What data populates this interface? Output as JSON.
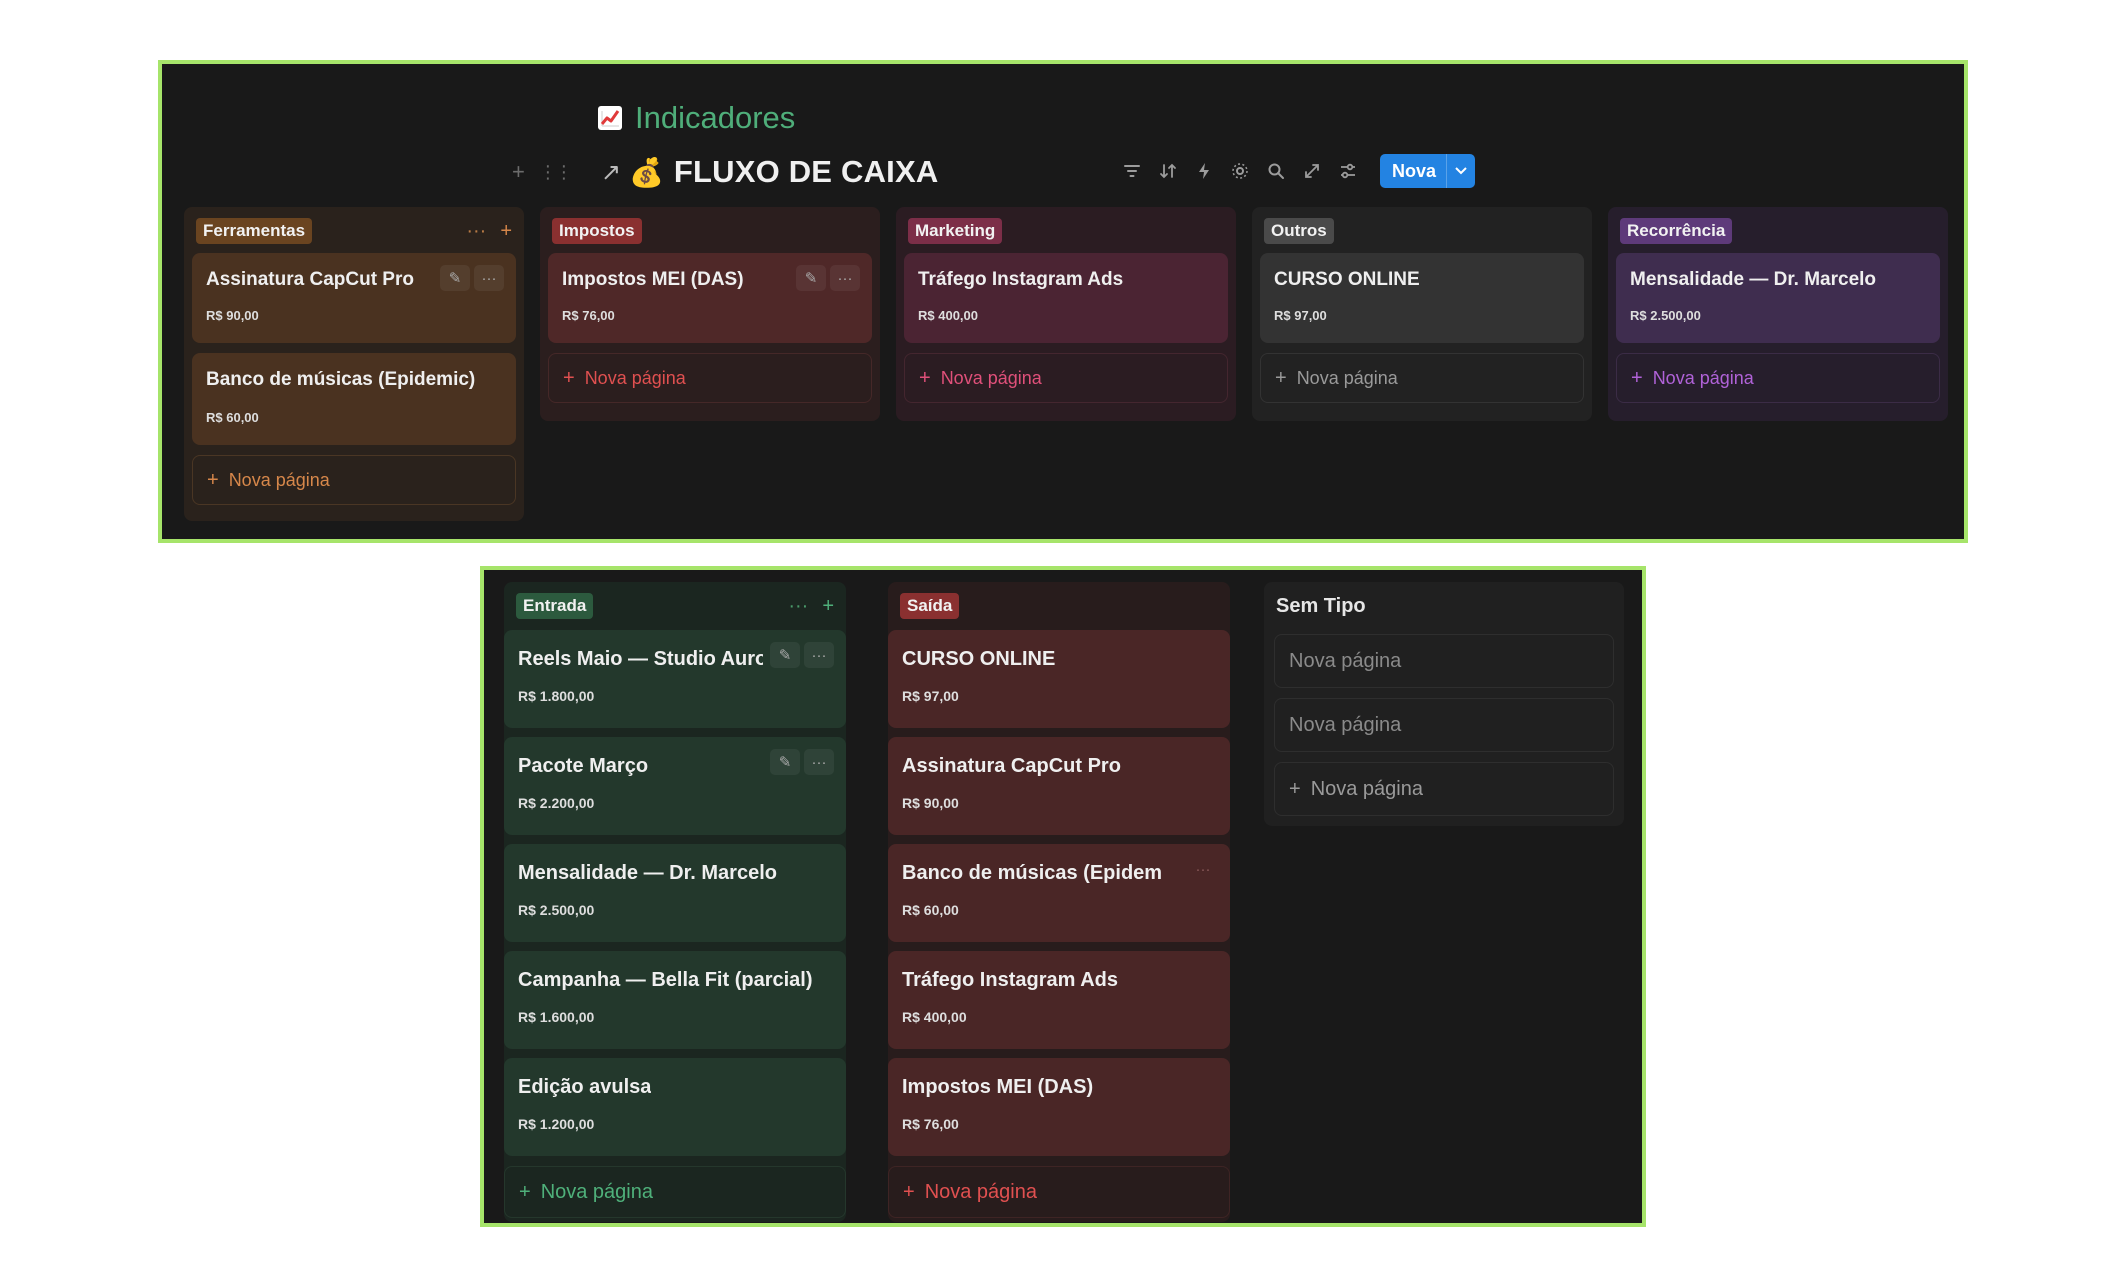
{
  "header": {
    "section_title": "Indicadores",
    "database_title": "FLUXO DE CAIXA",
    "new_button_label": "Nova",
    "icons": [
      "trending-up-icon",
      "money-bag-icon",
      "filter-icon",
      "sort-icon",
      "lightning-icon",
      "settings-icon",
      "search-icon",
      "expand-icon",
      "properties-icon"
    ]
  },
  "top_board": {
    "new_page_label": "Nova página",
    "columns": [
      {
        "name": "Ferramentas",
        "cards": [
          {
            "title": "Assinatura CapCut Pro",
            "value": "R$ 90,00"
          },
          {
            "title": "Banco de músicas (Epidemic)",
            "value": "R$ 60,00"
          }
        ]
      },
      {
        "name": "Impostos",
        "cards": [
          {
            "title": "Impostos MEI (DAS)",
            "value": "R$ 76,00"
          }
        ]
      },
      {
        "name": "Marketing",
        "cards": [
          {
            "title": "Tráfego Instagram Ads",
            "value": "R$ 400,00"
          }
        ]
      },
      {
        "name": "Outros",
        "cards": [
          {
            "title": "CURSO ONLINE",
            "value": "R$ 97,00"
          }
        ]
      },
      {
        "name": "Recorrência",
        "cards": [
          {
            "title": "Mensalidade — Dr. Marcelo",
            "value": "R$ 2.500,00"
          }
        ]
      }
    ]
  },
  "bottom_board": {
    "new_page_label": "Nova página",
    "columns": [
      {
        "name": "Entrada",
        "cards": [
          {
            "title": "Reels Maio — Studio Aurora",
            "value": "R$ 1.800,00"
          },
          {
            "title": "Pacote Março",
            "value": "R$ 2.200,00"
          },
          {
            "title": "Mensalidade — Dr. Marcelo",
            "value": "R$ 2.500,00"
          },
          {
            "title": "Campanha — Bella Fit (parcial)",
            "value": "R$ 1.600,00"
          },
          {
            "title": "Edição avulsa",
            "value": "R$ 1.200,00"
          }
        ]
      },
      {
        "name": "Saída",
        "cards": [
          {
            "title": "CURSO ONLINE",
            "value": "R$ 97,00"
          },
          {
            "title": "Assinatura CapCut Pro",
            "value": "R$ 90,00"
          },
          {
            "title": "Banco de músicas (Epidemic)",
            "value": "R$ 60,00"
          },
          {
            "title": "Tráfego Instagram Ads",
            "value": "R$ 400,00"
          },
          {
            "title": "Impostos MEI (DAS)",
            "value": "R$ 76,00"
          }
        ]
      },
      {
        "name": "Sem Tipo",
        "pages": [
          "Nova página",
          "Nova página"
        ]
      }
    ]
  },
  "colors": {
    "panel_border": "#a6e46a",
    "panel_bg": "#191919",
    "accent_blue": "#2383e2",
    "indicadores_green": "#4fae7a"
  }
}
